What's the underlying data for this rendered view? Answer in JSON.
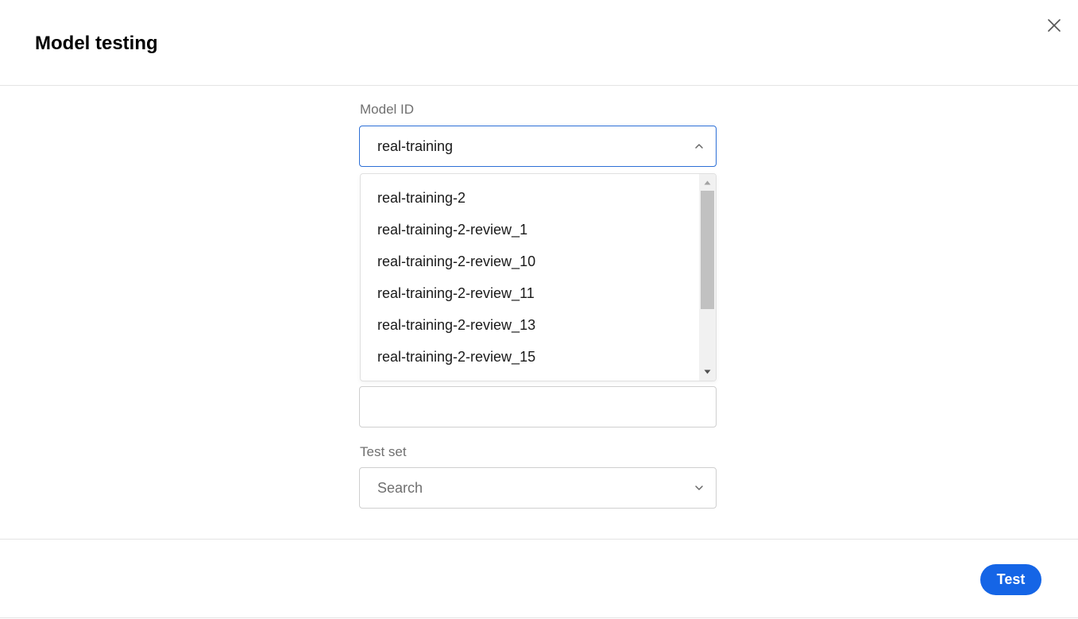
{
  "header": {
    "title": "Model testing"
  },
  "model_id": {
    "label": "Model ID",
    "value": "real-training",
    "options": [
      "real-training-2",
      "real-training-2-review_1",
      "real-training-2-review_10",
      "real-training-2-review_11",
      "real-training-2-review_13",
      "real-training-2-review_15"
    ]
  },
  "test_set": {
    "label": "Test set",
    "placeholder": "Search"
  },
  "footer": {
    "test_label": "Test"
  },
  "icons": {
    "close": "close-icon",
    "chevron_up": "chevron-up-icon",
    "chevron_down": "chevron-down-icon"
  },
  "colors": {
    "accent": "#1565e6",
    "focus_border": "#2d6fd6"
  }
}
